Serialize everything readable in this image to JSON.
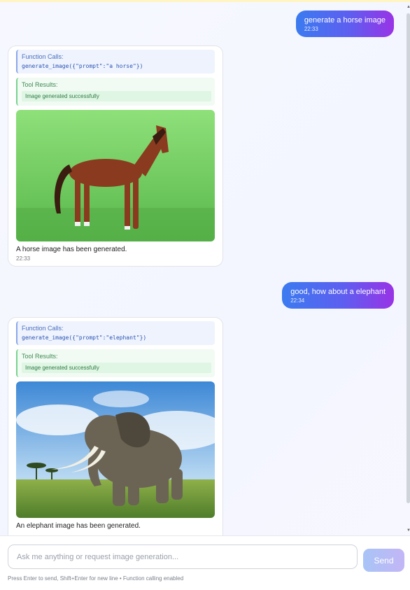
{
  "messages": [
    {
      "role": "user",
      "text": "generate a horse image",
      "time": "22:33"
    },
    {
      "role": "assistant",
      "function_calls_label": "Function Calls:",
      "function_call": "generate_image({\"prompt\":\"a horse\"})",
      "tool_results_label": "Tool Results:",
      "tool_result": "Image generated successfully",
      "image_subject": "horse",
      "caption": "A horse image has been generated.",
      "time": "22:33"
    },
    {
      "role": "user",
      "text": "good, how about a elephant",
      "time": "22:34"
    },
    {
      "role": "assistant",
      "function_calls_label": "Function Calls:",
      "function_call": "generate_image({\"prompt\":\"elephant\"})",
      "tool_results_label": "Tool Results:",
      "tool_result": "Image generated successfully",
      "image_subject": "elephant",
      "caption": "An elephant image has been generated."
    }
  ],
  "input": {
    "placeholder": "Ask me anything or request image generation...",
    "value": ""
  },
  "send_label": "Send",
  "hint": "Press Enter to send, Shift+Enter for new line • Function calling enabled",
  "colors": {
    "user_bubble_gradient": [
      "#3b7bf0",
      "#9933e6"
    ],
    "function_accent": "#2a52b5",
    "tool_accent": "#3f8a53",
    "send_button": "#b4bdf6"
  }
}
